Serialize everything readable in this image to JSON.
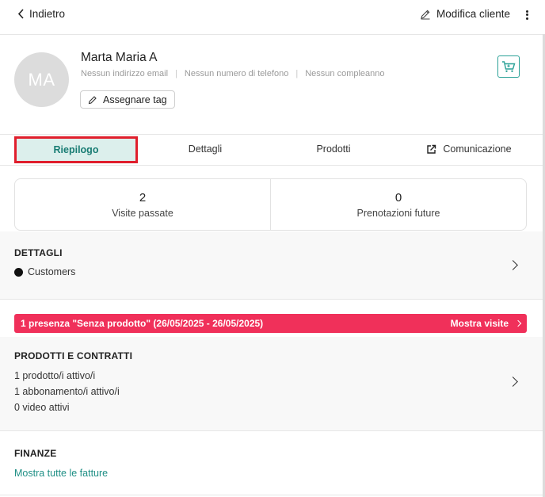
{
  "header": {
    "back_label": "Indietro",
    "edit_label": "Modifica cliente"
  },
  "profile": {
    "initials": "MA",
    "name": "Marta Maria A",
    "email": "Nessun indirizzo email",
    "phone": "Nessun numero di telefono",
    "birthday": "Nessun compleanno",
    "tag_button": "Assegnare tag"
  },
  "tabs": [
    {
      "label": "Riepilogo",
      "active": true
    },
    {
      "label": "Dettagli"
    },
    {
      "label": "Prodotti"
    },
    {
      "label": "Comunicazione"
    }
  ],
  "stats": [
    {
      "value": "2",
      "label": "Visite passate"
    },
    {
      "value": "0",
      "label": "Prenotazioni future"
    }
  ],
  "details": {
    "title": "DETTAGLI",
    "item": "Customers"
  },
  "alert": {
    "text": "1 presenza \"Senza prodotto\" (26/05/2025 - 26/05/2025)",
    "link": "Mostra visite",
    "color": "#f0305a"
  },
  "products": {
    "title": "PRODOTTI E CONTRATTI",
    "lines": [
      "1 prodotto/i attivo/i",
      "1 abbonamento/i attivo/i",
      "0 video attivi"
    ]
  },
  "finance": {
    "title": "FINANZE",
    "link": "Mostra tutte le fatture"
  },
  "colors": {
    "accent": "#1f8f85",
    "active_tab_bg": "#dcefec",
    "highlight_border": "#e01e2c"
  }
}
